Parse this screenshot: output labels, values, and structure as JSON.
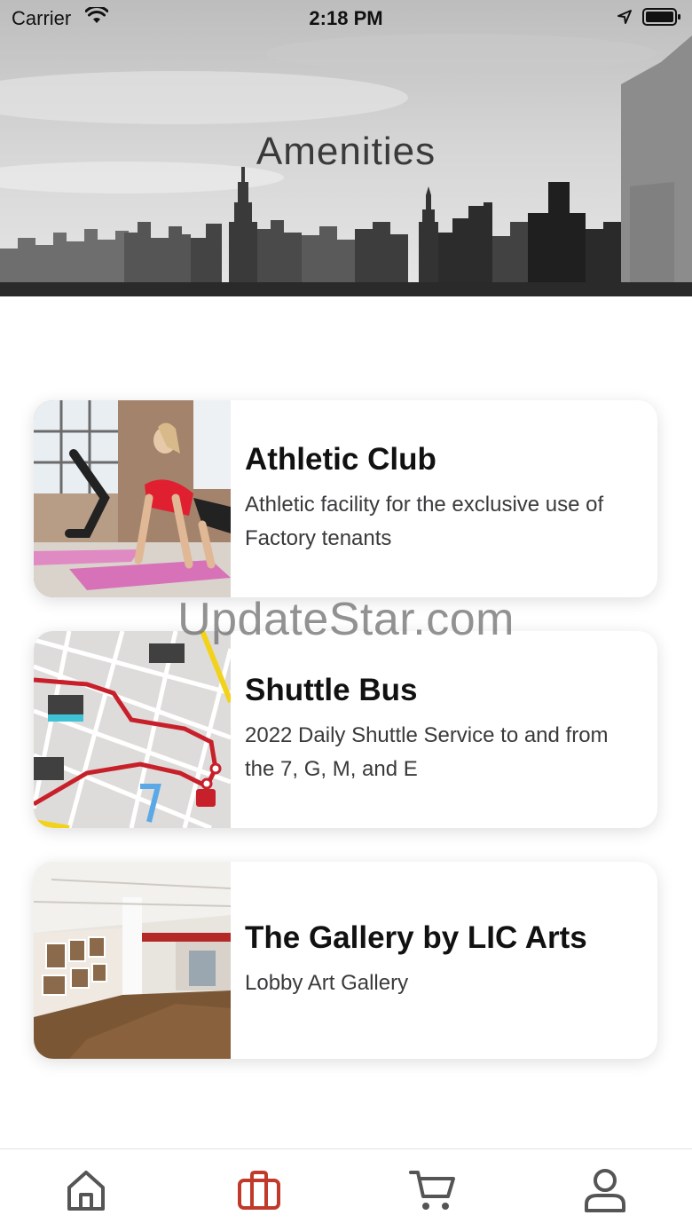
{
  "status_bar": {
    "carrier": "Carrier",
    "time": "2:18 PM"
  },
  "header": {
    "title": "Amenities"
  },
  "amenities": [
    {
      "title": "Athletic Club",
      "description": "Athletic facility for the exclusive use of Factory tenants",
      "image": "fitness-class-photo"
    },
    {
      "title": "Shuttle Bus",
      "description": "2022 Daily Shuttle Service to and from the 7, G, M, and E",
      "image": "shuttle-route-map"
    },
    {
      "title": "The Gallery by LIC Arts",
      "description": "Lobby Art Gallery",
      "image": "gallery-lobby-photo"
    }
  ],
  "watermark": "UpdateStar.com",
  "tab_bar": {
    "tabs": [
      {
        "icon": "home-icon",
        "active": false
      },
      {
        "icon": "briefcase-icon",
        "active": true
      },
      {
        "icon": "cart-icon",
        "active": false
      },
      {
        "icon": "profile-icon",
        "active": false
      }
    ],
    "active_color": "#c0392b",
    "inactive_color": "#555555"
  }
}
